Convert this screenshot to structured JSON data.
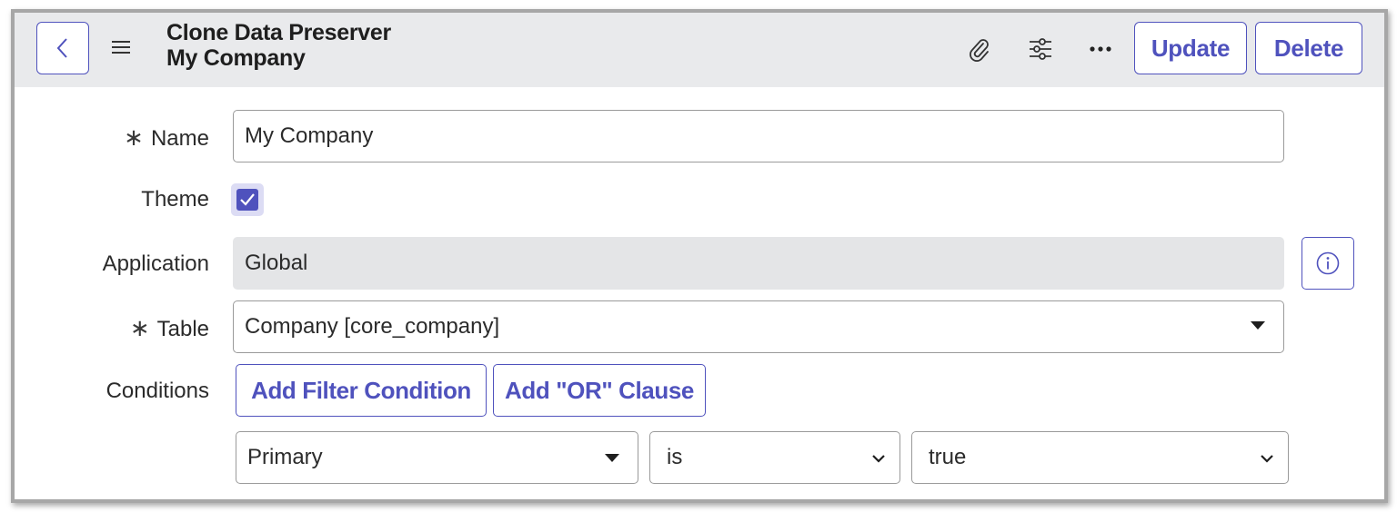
{
  "header": {
    "title_line1": "Clone Data Preserver",
    "title_line2": "My Company",
    "icons": [
      "back-icon",
      "hamburger-icon",
      "paperclip-icon",
      "sliders-icon",
      "more-icon"
    ],
    "update_label": "Update",
    "delete_label": "Delete"
  },
  "form": {
    "name": {
      "label": "Name",
      "required_mark": "∗",
      "value": "My Company"
    },
    "theme": {
      "label": "Theme",
      "checked": true
    },
    "application": {
      "label": "Application",
      "value": "Global",
      "info_icon": "info-icon"
    },
    "table": {
      "label": "Table",
      "required_mark": "∗",
      "value": "Company [core_company]"
    },
    "conditions": {
      "label": "Conditions",
      "add_filter_label": "Add Filter Condition",
      "add_or_label": "Add \"OR\" Clause",
      "row": {
        "field": "Primary",
        "operator": "is",
        "value": "true"
      }
    }
  },
  "colors": {
    "accent": "#4f52bd",
    "header_bg": "#e9eaec",
    "readonly_bg": "#e4e5e7"
  }
}
